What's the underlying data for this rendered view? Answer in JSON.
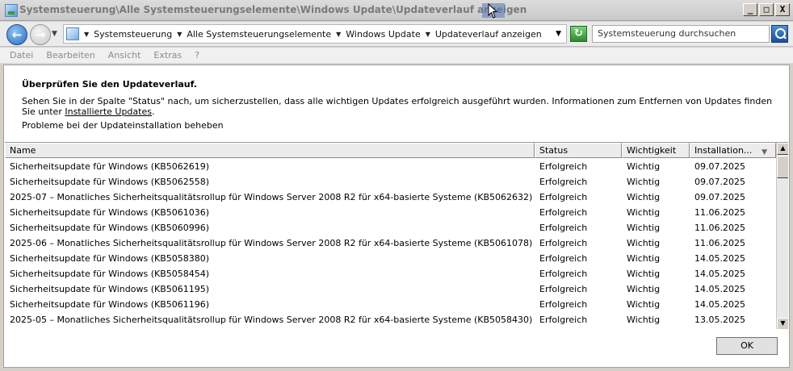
{
  "window": {
    "title": "Systemsteuerung\\Alle Systemsteuerungselemente\\Windows Update\\Updateverlauf anzeigen",
    "controls": {
      "minimize": "_",
      "maximize": "□",
      "close": "X"
    }
  },
  "address": {
    "crumbs": [
      "Systemsteuerung",
      "Alle Systemsteuerungselemente",
      "Windows Update",
      "Updateverlauf anzeigen"
    ],
    "search_placeholder": "Systemsteuerung durchsuchen"
  },
  "menu": [
    "Datei",
    "Bearbeiten",
    "Ansicht",
    "Extras",
    "?"
  ],
  "main": {
    "heading": "Überprüfen Sie den Updateverlauf.",
    "description": "Sehen Sie in der Spalte \"Status\" nach, um sicherzustellen, dass alle wichtigen Updates erfolgreich ausgeführt wurden. Informationen zum Entfernen von Updates finden Sie unter ",
    "installed_link": "Installierte Updates",
    "description_end": ".",
    "fix_link": "Probleme bei der Updateinstallation beheben"
  },
  "table": {
    "columns": [
      "Name",
      "Status",
      "Wichtigkeit",
      "Installation..."
    ],
    "rows": [
      [
        "Sicherheitsupdate für Windows (KB5062619)",
        "Erfolgreich",
        "Wichtig",
        "09.07.2025"
      ],
      [
        "Sicherheitsupdate für Windows (KB5062558)",
        "Erfolgreich",
        "Wichtig",
        "09.07.2025"
      ],
      [
        "2025-07 – Monatliches Sicherheitsqualitätsrollup für Windows Server 2008 R2 für x64-basierte Systeme (KB5062632)",
        "Erfolgreich",
        "Wichtig",
        "09.07.2025"
      ],
      [
        "Sicherheitsupdate für Windows (KB5061036)",
        "Erfolgreich",
        "Wichtig",
        "11.06.2025"
      ],
      [
        "Sicherheitsupdate für Windows (KB5060996)",
        "Erfolgreich",
        "Wichtig",
        "11.06.2025"
      ],
      [
        "2025-06 – Monatliches Sicherheitsqualitätsrollup für Windows Server 2008 R2 für x64-basierte Systeme (KB5061078)",
        "Erfolgreich",
        "Wichtig",
        "11.06.2025"
      ],
      [
        "Sicherheitsupdate für Windows (KB5058380)",
        "Erfolgreich",
        "Wichtig",
        "14.05.2025"
      ],
      [
        "Sicherheitsupdate für Windows (KB5058454)",
        "Erfolgreich",
        "Wichtig",
        "14.05.2025"
      ],
      [
        "Sicherheitsupdate für Windows (KB5061195)",
        "Erfolgreich",
        "Wichtig",
        "14.05.2025"
      ],
      [
        "Sicherheitsupdate für Windows (KB5061196)",
        "Erfolgreich",
        "Wichtig",
        "14.05.2025"
      ],
      [
        "2025-05 – Monatliches Sicherheitsqualitätsrollup für Windows Server 2008 R2 für x64-basierte Systeme (KB5058430)",
        "Erfolgreich",
        "Wichtig",
        "13.05.2025"
      ]
    ]
  },
  "buttons": {
    "ok": "OK"
  },
  "icons": {
    "back": "back-arrow-icon",
    "forward": "forward-arrow-icon",
    "refresh": "refresh-icon",
    "search": "search-icon",
    "sort": "sort-desc-icon"
  }
}
